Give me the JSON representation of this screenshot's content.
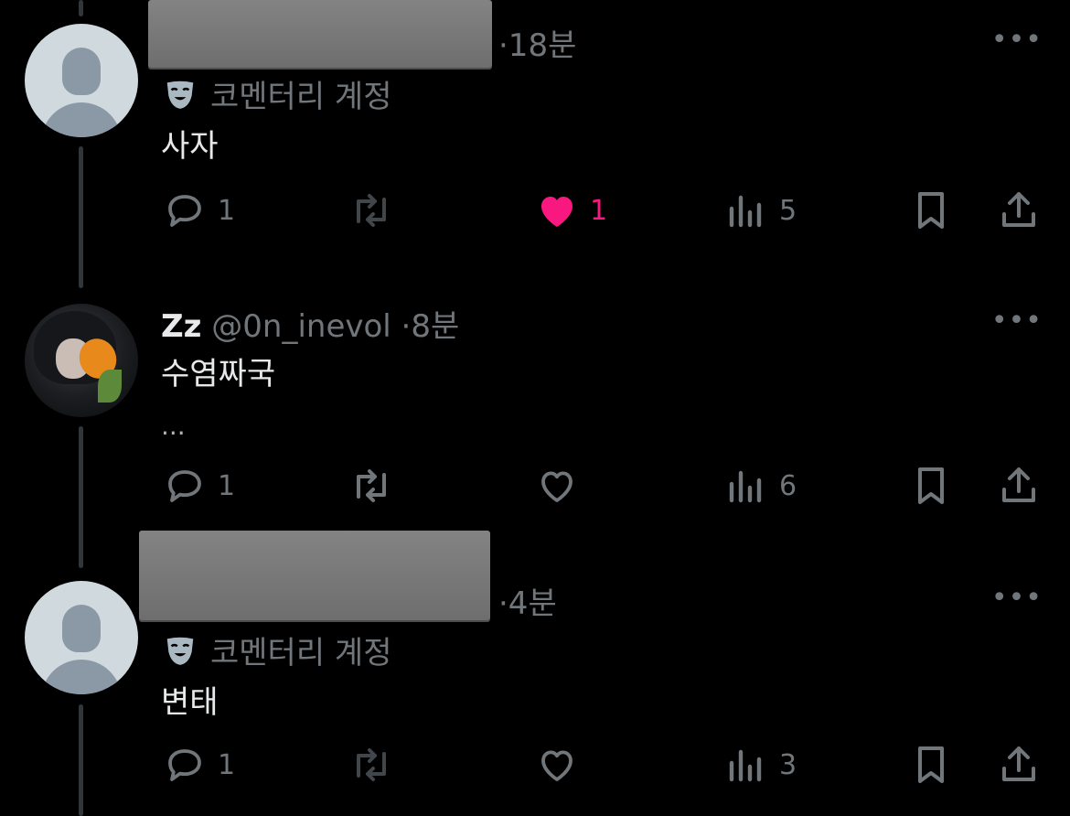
{
  "tweets": [
    {
      "handle": "",
      "name": "",
      "time": "·18분",
      "label": "코멘터리 계정",
      "text": "사자",
      "avatar": "default-avatar",
      "redacted": true,
      "stats": {
        "replies": "1",
        "reposts": "",
        "likes": "1",
        "views": "5",
        "liked": true
      }
    },
    {
      "name": "Zz",
      "handle": "@0n_inevol",
      "time": "·8분",
      "label": "",
      "text": "수염짜국",
      "text2": "...",
      "avatar": "photo-avatar",
      "redacted": false,
      "stats": {
        "replies": "1",
        "reposts": "",
        "likes": "",
        "views": "6",
        "liked": false
      }
    },
    {
      "handle": "",
      "name": "",
      "time": "·4분",
      "label": "코멘터리 계정",
      "text": "변태",
      "avatar": "default-avatar",
      "redacted": true,
      "stats": {
        "replies": "1",
        "reposts": "",
        "likes": "",
        "views": "3",
        "liked": false
      }
    }
  ],
  "more_glyph": "•••",
  "colors": {
    "accent_like": "#f91880",
    "muted": "#71767b",
    "background": "#000000"
  },
  "icons": [
    "reply-icon",
    "repost-icon",
    "like-icon",
    "views-icon",
    "bookmark-icon",
    "share-icon",
    "mask-icon",
    "more-icon"
  ]
}
